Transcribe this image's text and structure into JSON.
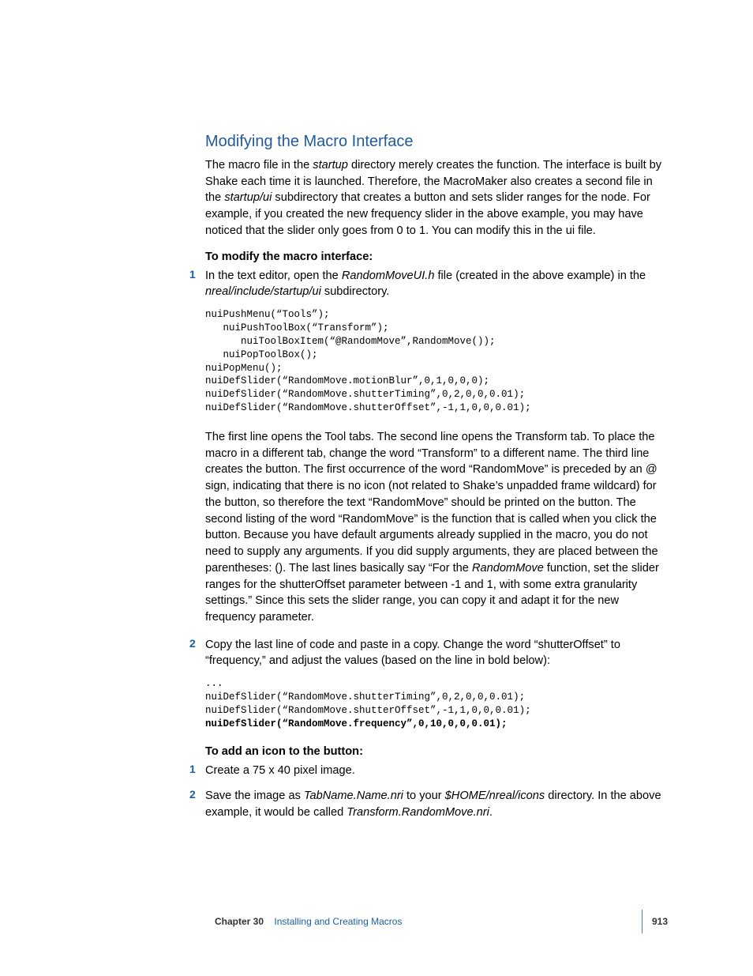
{
  "heading": "Modifying the Macro Interface",
  "p1_a": "The macro file in the ",
  "p1_i1": "startup",
  "p1_b": " directory merely creates the function. The interface is built by Shake each time it is launched. Therefore, the MacroMaker also creates a second file in the ",
  "p1_i2": "startup/ui",
  "p1_c": " subdirectory that creates a button and sets slider ranges for the node. For example, if you created the new frequency slider in the above example, you may have noticed that the slider only goes from 0 to 1. You can modify this in the ui file.",
  "h_modify": "To modify the macro interface:",
  "step1_num": "1",
  "step1_a": "In the text editor, open the ",
  "step1_i1": "RandomMoveUI.h",
  "step1_b": " file (created in the above example) in the ",
  "step1_i2": "nreal/include/startup/ui",
  "step1_c": " subdirectory.",
  "code1": "nuiPushMenu(“Tools”);\n   nuiPushToolBox(“Transform”);\n      nuiToolBoxItem(“@RandomMove”,RandomMove());\n   nuiPopToolBox();\nnuiPopMenu();\nnuiDefSlider(“RandomMove.motionBlur”,0,1,0,0,0);\nnuiDefSlider(“RandomMove.shutterTiming”,0,2,0,0,0.01);\nnuiDefSlider(“RandomMove.shutterOffset”,-1,1,0,0,0.01);",
  "p2_a": "The first line opens the Tool tabs. The second line opens the Transform tab. To place the macro in a different tab, change the word “Transform” to a different name. The third line creates the button. The first occurrence of the word “RandomMove” is preceded by an @ sign, indicating that there is no icon (not related to Shake’s unpadded frame wildcard) for the button, so therefore the text “RandomMove” should be printed on the button. The second listing of the word “RandomMove” is the function that is called when you click the button. Because you have default arguments already supplied in the macro, you do not need to supply any arguments. If you did supply arguments, they are placed between the parentheses:  (). The last lines basically say “For the ",
  "p2_i1": "RandomMove",
  "p2_b": " function, set the slider ranges for the shutterOffset parameter between -1 and 1, with some extra granularity settings.” Since this sets the slider range, you can copy it and adapt it for the new frequency parameter.",
  "step2_num": "2",
  "step2": "Copy the last line of code and paste in a copy. Change the word “shutterOffset” to “frequency,” and adjust the values (based on the line in bold below):",
  "code2_plain": "...\nnuiDefSlider(“RandomMove.shutterTiming”,0,2,0,0,0.01);\nnuiDefSlider(“RandomMove.shutterOffset”,-1,1,0,0,0.01);\n",
  "code2_bold": "nuiDefSlider(“RandomMove.frequency”,0,10,0,0,0.01);",
  "h_icon": "To add an icon to the button:",
  "icon1_num": "1",
  "icon1": "Create a 75 x 40 pixel image.",
  "icon2_num": "2",
  "icon2_a": "Save the image as ",
  "icon2_i1": "TabName.Name.nri",
  "icon2_b": " to your ",
  "icon2_i2": "$HOME/nreal/icons",
  "icon2_c": " directory. In the above example, it would be called ",
  "icon2_i3": "Transform.RandomMove.nri",
  "icon2_d": ".",
  "footer_chapter": "Chapter 30",
  "footer_title": "Installing and Creating Macros",
  "footer_page": "913"
}
